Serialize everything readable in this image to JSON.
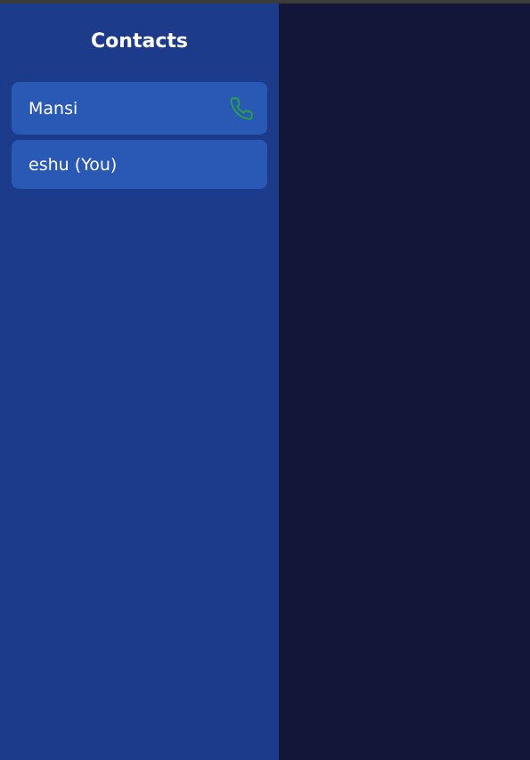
{
  "sidebar": {
    "title": "Contacts",
    "contacts": [
      {
        "name": "Mansi",
        "icon": "phone-icon",
        "icon_color": "#27a544"
      },
      {
        "name": "eshu (You)"
      }
    ]
  },
  "colors": {
    "sidebar_bg": "#1d3b8b",
    "contact_bg": "#2958b5",
    "main_bg": "#131639",
    "call_icon": "#27a544"
  }
}
